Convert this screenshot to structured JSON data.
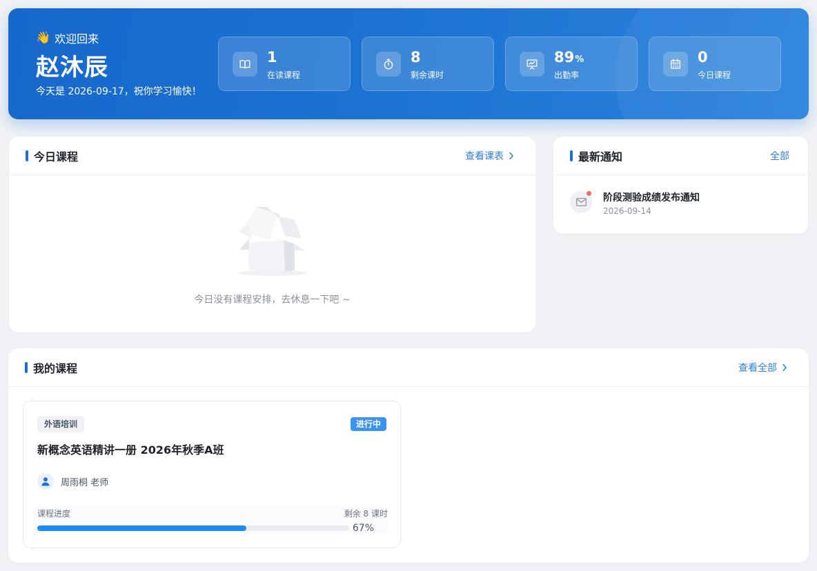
{
  "header": {
    "greeting": "欢迎回来",
    "user_name": "赵沐辰",
    "date_line": "今天是 2026-09-17，祝你学习愉快！",
    "stats": [
      {
        "value": "1",
        "unit": "",
        "label": "在读课程",
        "icon": "book-icon"
      },
      {
        "value": "8",
        "unit": "",
        "label": "剩余课时",
        "icon": "stopwatch-icon"
      },
      {
        "value": "89",
        "unit": "%",
        "label": "出勤率",
        "icon": "chart-board-icon"
      },
      {
        "value": "0",
        "unit": "",
        "label": "今日课程",
        "icon": "calendar-icon"
      }
    ]
  },
  "today": {
    "title": "今日课程",
    "link": "查看课表",
    "empty_text": "今日没有课程安排，去休息一下吧 ~"
  },
  "notices": {
    "title": "最新通知",
    "link": "全部",
    "items": [
      {
        "title": "阶段测验成绩发布通知",
        "date": "2026-09-14",
        "unread": true
      }
    ]
  },
  "courses": {
    "title": "我的课程",
    "link": "查看全部",
    "items": [
      {
        "category": "外语培训",
        "status": "进行中",
        "name": "新概念英语精讲一册 2026年秋季A班",
        "teacher": "周雨桐 老师",
        "progress_label": "课程进度",
        "remaining": "剩余 8 课时",
        "progress": 0.67,
        "progress_text": "67%"
      }
    ]
  },
  "colors": {
    "accent": "#1b6fd1",
    "progress": "#1d8cf0",
    "status": "#3b93f0",
    "unread_dot": "#f06a6a"
  }
}
